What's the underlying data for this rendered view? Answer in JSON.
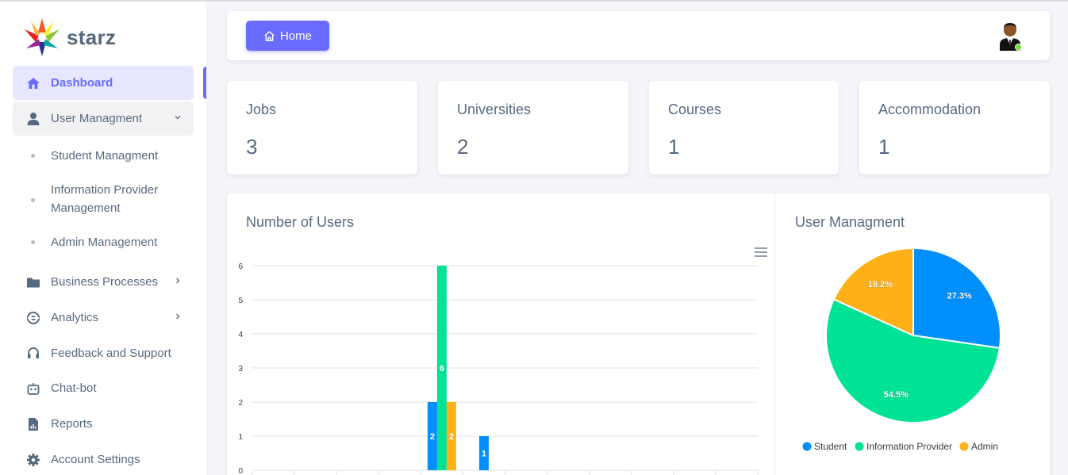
{
  "brand": {
    "name": "starz"
  },
  "sidebar": {
    "items": [
      {
        "label": "Dashboard",
        "icon": "home-icon"
      },
      {
        "label": "User Managment",
        "icon": "user-icon"
      },
      {
        "label": "Business Processes",
        "icon": "folder-icon"
      },
      {
        "label": "Analytics",
        "icon": "analytics-icon"
      },
      {
        "label": "Feedback and Support",
        "icon": "headset-icon"
      },
      {
        "label": "Chat-bot",
        "icon": "bot-icon"
      },
      {
        "label": "Reports",
        "icon": "report-icon"
      },
      {
        "label": "Account Settings",
        "icon": "gear-icon"
      }
    ],
    "sub_items": [
      {
        "label": "Student Managment"
      },
      {
        "label": "Information Provider Management"
      },
      {
        "label": "Admin Management"
      }
    ]
  },
  "header": {
    "home_label": "Home"
  },
  "stats": [
    {
      "title": "Jobs",
      "value": "3"
    },
    {
      "title": "Universities",
      "value": "2"
    },
    {
      "title": "Courses",
      "value": "1"
    },
    {
      "title": "Accommodation",
      "value": "1"
    }
  ],
  "colors": {
    "accent": "#696cff",
    "student": "#008ffb",
    "info_provider": "#00e396",
    "admin": "#feb019"
  },
  "chart_data": [
    {
      "type": "bar",
      "title": "Number of Users",
      "ylim": [
        0,
        6
      ],
      "yticks": [
        "0",
        "1",
        "2",
        "3",
        "4",
        "5",
        "6"
      ],
      "grid": true,
      "x_slots": 12,
      "groups": [
        {
          "slot": 4,
          "values": [
            2,
            6,
            2
          ],
          "labels": [
            "2",
            "6",
            "2"
          ]
        },
        {
          "slot": 5,
          "values": [
            1
          ],
          "labels": [
            "1"
          ]
        }
      ]
    },
    {
      "type": "pie",
      "title": "User Managment",
      "slices": [
        {
          "name": "Student",
          "value": 27.3,
          "label": "27.3%"
        },
        {
          "name": "Information Provider",
          "value": 54.5,
          "label": "54.5%"
        },
        {
          "name": "Admin",
          "value": 18.2,
          "label": "18.2%"
        }
      ],
      "legend": "bottom"
    }
  ]
}
